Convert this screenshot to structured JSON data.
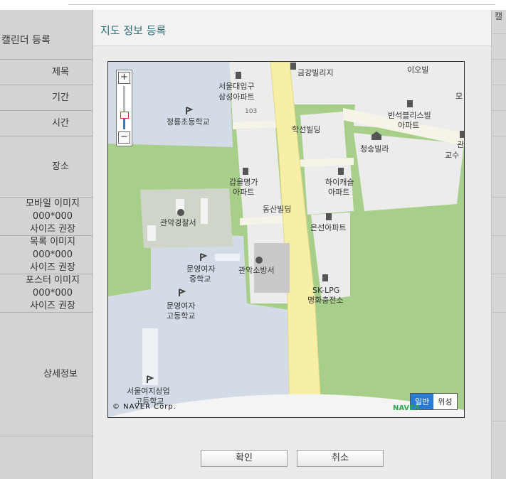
{
  "background": {
    "page_title": "캘린더 등록",
    "right_label": "캘",
    "rows": [
      {
        "label": "제목"
      },
      {
        "label": "기간"
      },
      {
        "label": "시간"
      },
      {
        "label": "장소"
      },
      {
        "label": "모바일 이미지\n000*000\n사이즈 권장"
      },
      {
        "label": "목록 이미지\n000*000\n사이즈 권장"
      },
      {
        "label": "포스터 이미지\n000*000\n사이즈 권장"
      },
      {
        "label": "상세정보"
      }
    ]
  },
  "dialog": {
    "title": "지도 정보 등록",
    "confirm_label": "확인",
    "cancel_label": "취소"
  },
  "map": {
    "copyright": "© NAVER Corp.",
    "logo": "NAVER",
    "zoom_in": "+",
    "zoom_out": "−",
    "map_types": [
      "일반",
      "위성"
    ],
    "labels": {
      "geumgang": "금강빌리지",
      "iobil": "이오빌",
      "mo": "모",
      "seoul_daeipgu1": "서울대입구",
      "seoul_daeipgu2": "삼성아파트",
      "num_103": "103",
      "cheongryong": "청룡초등학교",
      "hakseon": "학선빌딩",
      "banseok1": "반석블리스빌",
      "banseok2": "아파트",
      "cheongsong": "청송빌라",
      "gwan1": "관",
      "gwan2": "교수",
      "gabeul1": "갑을명가",
      "gabeul2": "아파트",
      "haica1": "하이캐슬",
      "haica2": "아파트",
      "dongsan": "동산빌딩",
      "police": "관악경찰서",
      "eunseon": "은선아파트",
      "munyeong_mid1": "문영여자",
      "munyeong_mid2": "중학교",
      "fire": "관악소방서",
      "sklpg1": "SK-LPG",
      "sklpg2": "명화충전소",
      "munyeong_high1": "문영여자",
      "munyeong_high2": "고등학교",
      "seoul_girls1": "서울여지상업",
      "seoul_girls2": "고등학교"
    }
  }
}
